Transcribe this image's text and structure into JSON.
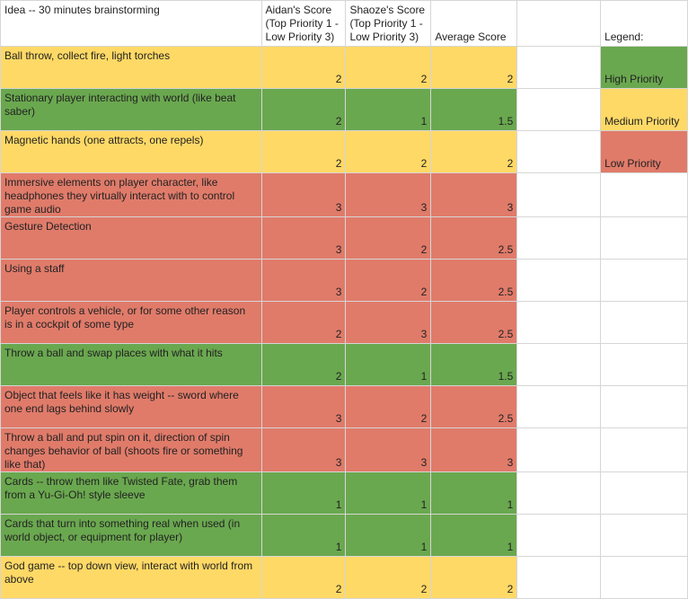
{
  "header": {
    "idea": "Idea -- 30 minutes brainstorming",
    "aidan": "Aidan's Score (Top Priority 1 - Low Priority 3)",
    "shaoze": "Shaoze's Score (Top Priority 1 - Low Priority 3)",
    "average": "Average Score",
    "legend": "Legend:"
  },
  "legend": {
    "high": "High Priority",
    "medium": "Medium Priority",
    "low": "Low Priority"
  },
  "colors": {
    "high": "#6aa84f",
    "medium": "#ffd966",
    "low": "#e07b6a"
  },
  "rows": [
    {
      "idea": "Ball throw, collect fire, light torches",
      "aidan": "2",
      "shaoze": "2",
      "avg": "2",
      "priority": "medium"
    },
    {
      "idea": "Stationary player interacting with world (like beat saber)",
      "aidan": "2",
      "shaoze": "1",
      "avg": "1.5",
      "priority": "high"
    },
    {
      "idea": "Magnetic hands (one attracts, one repels)",
      "aidan": "2",
      "shaoze": "2",
      "avg": "2",
      "priority": "medium"
    },
    {
      "idea": "Immersive elements on player character, like headphones they virtually interact with to control game audio",
      "aidan": "3",
      "shaoze": "3",
      "avg": "3",
      "priority": "low"
    },
    {
      "idea": "Gesture Detection",
      "aidan": "3",
      "shaoze": "2",
      "avg": "2.5",
      "priority": "low"
    },
    {
      "idea": "Using a staff",
      "aidan": "3",
      "shaoze": "2",
      "avg": "2.5",
      "priority": "low"
    },
    {
      "idea": "Player controls a vehicle, or for some other reason is in a cockpit of some type",
      "aidan": "2",
      "shaoze": "3",
      "avg": "2.5",
      "priority": "low"
    },
    {
      "idea": "Throw a ball and swap places with what it hits",
      "aidan": "2",
      "shaoze": "1",
      "avg": "1.5",
      "priority": "high"
    },
    {
      "idea": "Object that feels like it has weight  -- sword where one end lags behind slowly",
      "aidan": "3",
      "shaoze": "2",
      "avg": "2.5",
      "priority": "low"
    },
    {
      "idea": "Throw a ball and put spin on it, direction of spin changes behavior of ball (shoots fire or something like that)",
      "aidan": "3",
      "shaoze": "3",
      "avg": "3",
      "priority": "low"
    },
    {
      "idea": "Cards -- throw them like Twisted Fate, grab them from a Yu-Gi-Oh! style sleeve",
      "aidan": "1",
      "shaoze": "1",
      "avg": "1",
      "priority": "high"
    },
    {
      "idea": "Cards that turn into something real when used (in world object, or equipment for player)",
      "aidan": "1",
      "shaoze": "1",
      "avg": "1",
      "priority": "high"
    },
    {
      "idea": "God game -- top down view, interact with world from above",
      "aidan": "2",
      "shaoze": "2",
      "avg": "2",
      "priority": "medium"
    }
  ]
}
